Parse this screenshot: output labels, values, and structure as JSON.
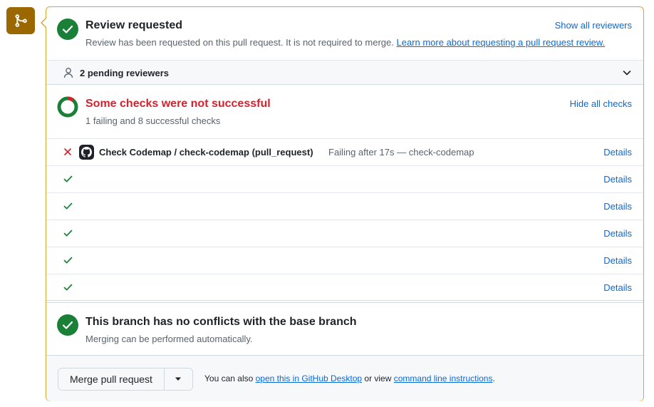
{
  "colors": {
    "merge_badge": "#9a6700",
    "box_border": "#d4a72c",
    "success": "#1a7f37",
    "danger": "#d1242f",
    "link": "#0969da",
    "muted": "#59636e"
  },
  "badge": {
    "icon": "git-merge-icon"
  },
  "review": {
    "icon": "check-circle-icon",
    "title": "Review requested",
    "description": "Review has been requested on this pull request. It is not required to merge.",
    "learn_more_link": "Learn more about requesting a pull request review.",
    "show_all_reviewers": "Show all reviewers"
  },
  "reviewers": {
    "icon": "person-icon",
    "label": "2 pending reviewers",
    "toggle_icon": "chevron-down-icon"
  },
  "checks": {
    "icon": "checks-ring-icon",
    "title": "Some checks were not successful",
    "summary": "1 failing and 8 successful checks",
    "hide_all_checks": "Hide all checks",
    "rows": [
      {
        "status": "failure",
        "icon": "x-icon",
        "app_icon": "github-icon",
        "name": "Check Codemap / check-codemap (pull_request)",
        "description": "Failing after 17s — check-codemap",
        "details": "Details"
      },
      {
        "status": "success",
        "icon": "check-icon",
        "details": "Details"
      },
      {
        "status": "success",
        "icon": "check-icon",
        "details": "Details"
      },
      {
        "status": "success",
        "icon": "check-icon",
        "details": "Details"
      },
      {
        "status": "success",
        "icon": "check-icon",
        "details": "Details"
      },
      {
        "status": "success",
        "icon": "check-icon",
        "details": "Details"
      }
    ]
  },
  "conflicts": {
    "icon": "check-circle-icon",
    "title": "This branch has no conflicts with the base branch",
    "description": "Merging can be performed automatically."
  },
  "merge": {
    "button_label": "Merge pull request",
    "dropdown_icon": "triangle-down-icon",
    "note_prefix": "You can also",
    "desktop_link": "open this in GitHub Desktop",
    "note_middle": "or view",
    "cli_link": "command line instructions",
    "note_suffix": "."
  }
}
